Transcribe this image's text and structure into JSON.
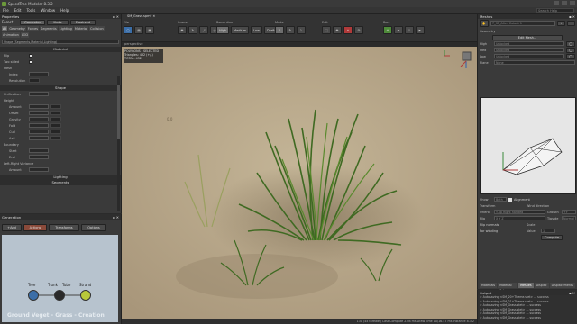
{
  "window": {
    "title": "SpeedTree Modeler 8.3.2"
  },
  "menu": {
    "items": [
      "File",
      "Edit",
      "Tools",
      "Window",
      "Help"
    ],
    "search_placeholder": "Search Help"
  },
  "toolbar": {
    "tab_label": "SM_Grass.spm*",
    "groups": [
      {
        "label": "File",
        "buttons": [
          "",
          "",
          ""
        ]
      },
      {
        "label": "Scene",
        "buttons": [
          "",
          "",
          "",
          ""
        ]
      },
      {
        "label": "Resolution",
        "buttons": [
          "High",
          "Medium",
          "Low",
          "Draft"
        ]
      },
      {
        "label": "Mode",
        "buttons": [
          "",
          "",
          ""
        ]
      },
      {
        "label": "Edit",
        "buttons": [
          "",
          "",
          "",
          ""
        ]
      },
      {
        "label": "Post",
        "buttons": [
          "",
          "",
          "",
          ""
        ]
      }
    ]
  },
  "properties": {
    "title": "Properties",
    "forest_label": "Forest",
    "generator_label": "Generator",
    "node_label": "Node",
    "freehand_label": "Freehand",
    "tabs": [
      "All",
      "Geometry",
      "Forces",
      "Segments",
      "Lighting",
      "Material",
      "Collision",
      "Animation",
      "LOD"
    ],
    "selected_tab": "All",
    "filter_placeholder": "Shape (Segments,Material,Lighting)",
    "sections": {
      "material": "Material",
      "shape": "Shape",
      "lighting": "Lighting",
      "segments": "Segments"
    },
    "material_rows": [
      {
        "name": "Flip",
        "kind": "check"
      },
      {
        "name": "Two sided",
        "kind": "check"
      }
    ],
    "mesh_label": "Mesh",
    "mesh_rows": [
      {
        "name": "Index",
        "kind": "field"
      },
      {
        "name": "Resolution",
        "kind": "curve"
      }
    ],
    "shape_rows": [
      {
        "name": "Unification",
        "kind": "field"
      }
    ],
    "height_label": "Height",
    "height_rows": [
      {
        "name": "Amount",
        "kind": "field"
      },
      {
        "name": "Offset",
        "kind": "field"
      }
    ],
    "spine_rows": [
      {
        "name": "Gravity",
        "kind": "field"
      },
      {
        "name": "Fold",
        "kind": "field"
      },
      {
        "name": "Curl",
        "kind": "field"
      },
      {
        "name": "Axil",
        "kind": "field"
      }
    ],
    "boundary_label": "Boundary",
    "boundary_rows": [
      {
        "name": "Start",
        "kind": "field"
      },
      {
        "name": "End",
        "kind": "field"
      }
    ],
    "lr_variance_label": "Left-Right Variance",
    "lr_rows": [
      {
        "name": "Amount",
        "kind": "field"
      }
    ]
  },
  "generation": {
    "title": "Generation",
    "buttons": [
      "Add",
      "Actions",
      "Transforms",
      "Options"
    ],
    "nodes": [
      "Tree",
      "Trunk",
      "Tube",
      "Strand"
    ],
    "watermark": "Ground Veget - Grass - Creation"
  },
  "viewport": {
    "tab": "perspective",
    "info_lines": [
      "POLYGONS - SELECTED",
      "Triangles:   432 (+/-)",
      "TOTAL: 432"
    ],
    "status": "130 (4x threads) Last Compute 2.08 ms Draw time 10/16.47 ms  Instance 8.3.2"
  },
  "meshes": {
    "title": "Meshes",
    "selected_mesh": "7_SP_Allen Cutout 1",
    "geometry_label": "Geometry",
    "edit_mesh_label": "Edit Mesh...",
    "lod_rows": [
      {
        "label": "High",
        "value": "Unlocked"
      },
      {
        "label": "Med",
        "value": "Unlocked"
      },
      {
        "label": "Low",
        "value": "Unlocked"
      }
    ],
    "planes_label": "Plane",
    "planes_value": "None",
    "show_label": "Show",
    "show_value": "Both",
    "alignment_label": "Alignment",
    "transform_label": "Transform",
    "orient_label": "Orient",
    "orient_value": "Y-up Right handed",
    "flip_label": "Flip",
    "flip_value": "X Y Z",
    "flip_normals_label": "Flip normals",
    "for_winding_label": "For winding",
    "wind_direction_label": "Wind direction",
    "growth_label": "Growth",
    "growth_value": "+Y",
    "tipside_label": "Tipside",
    "tipside_value": "Normal",
    "scale_label": "Scale",
    "value_label": "Value",
    "value_value": "1",
    "compute_label": "Compute",
    "bottom_tabs": [
      "Materials",
      "Material Sets",
      "Meshes",
      "Displac",
      "Displacements"
    ],
    "selected_bottom_tab": "Meshes"
  },
  "output": {
    "title": "Output",
    "lines": [
      "> Autosaving <SM_20+Theme.stet> ... success",
      "> Autosaving <SM_21+Theme.stet> ... success",
      "> Autosaving <SM_Grass.stet> ... success",
      "> Autosaving <SM_Grass.stet> ... success",
      "> Autosaving <SM_Grass.stet> ... success",
      "> Autosaving <SM_Grass.stet> ... success"
    ]
  }
}
